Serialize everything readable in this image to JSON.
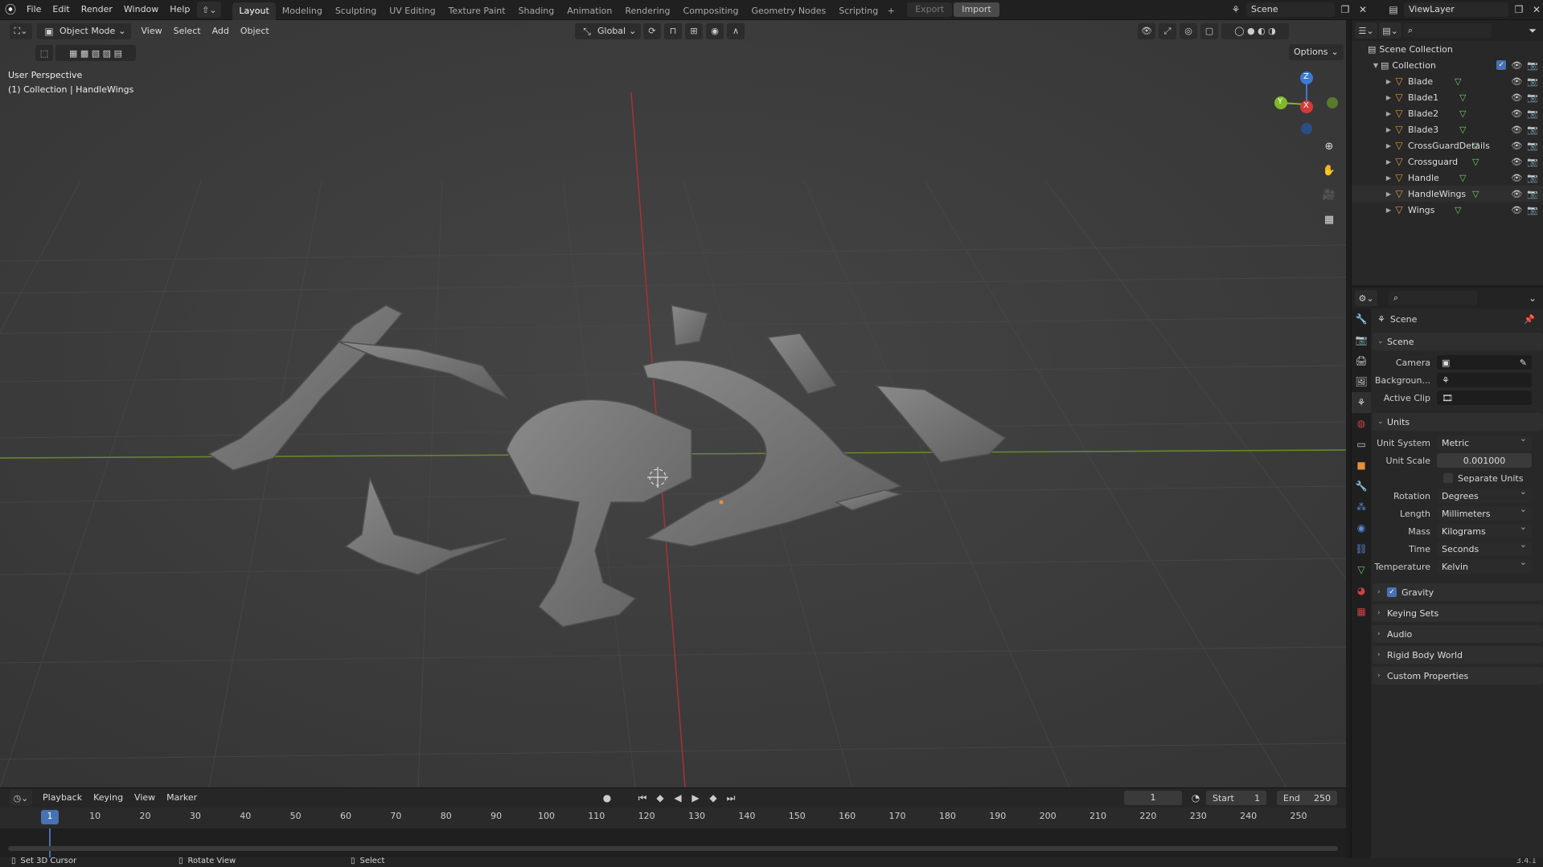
{
  "app": {
    "version": "3.4.1"
  },
  "topbar": {
    "menus": [
      "File",
      "Edit",
      "Render",
      "Window",
      "Help"
    ],
    "workspaces": [
      "Layout",
      "Modeling",
      "Sculpting",
      "UV Editing",
      "Texture Paint",
      "Shading",
      "Animation",
      "Rendering",
      "Compositing",
      "Geometry Nodes",
      "Scripting"
    ],
    "active_workspace": "Layout",
    "export_label": "Export",
    "import_label": "Import",
    "scene_name": "Scene",
    "viewlayer_name": "ViewLayer"
  },
  "viewport": {
    "mode": "Object Mode",
    "menus": [
      "View",
      "Select",
      "Add",
      "Object"
    ],
    "transform_orientation": "Global",
    "options_label": "Options",
    "perspective_label": "User Perspective",
    "collection_info": "(1) Collection | HandleWings",
    "gizmo": {
      "x_label": "X",
      "y_label": "Y",
      "z_label": "Z"
    }
  },
  "timeline": {
    "menus": [
      "Playback",
      "Keying",
      "View",
      "Marker"
    ],
    "current_frame": "1",
    "start_label": "Start",
    "start_value": "1",
    "end_label": "End",
    "end_value": "250",
    "ticks": [
      "1",
      "10",
      "20",
      "30",
      "40",
      "50",
      "60",
      "70",
      "80",
      "90",
      "100",
      "110",
      "120",
      "130",
      "140",
      "150",
      "160",
      "170",
      "180",
      "190",
      "200",
      "210",
      "220",
      "230",
      "240",
      "250"
    ]
  },
  "statusbar": {
    "hint1": "Set 3D Cursor",
    "hint2": "Rotate View",
    "hint3": "Select"
  },
  "outliner": {
    "root": "Scene Collection",
    "collection": "Collection",
    "items": [
      "Blade",
      "Blade1",
      "Blade2",
      "Blade3",
      "CrossGuardDetails",
      "Crossguard",
      "Handle",
      "HandleWings",
      "Wings"
    ]
  },
  "properties": {
    "context": "Scene",
    "scene_panel": "Scene",
    "camera_label": "Camera",
    "background_label": "Backgroun...",
    "active_clip_label": "Active Clip",
    "units_panel": "Units",
    "unit_system_label": "Unit System",
    "unit_system": "Metric",
    "unit_scale_label": "Unit Scale",
    "unit_scale": "0.001000",
    "separate_units": "Separate Units",
    "rotation_label": "Rotation",
    "rotation": "Degrees",
    "length_label": "Length",
    "length": "Millimeters",
    "mass_label": "Mass",
    "mass": "Kilograms",
    "time_label": "Time",
    "time": "Seconds",
    "temperature_label": "Temperature",
    "temperature": "Kelvin",
    "gravity": "Gravity",
    "keying_sets": "Keying Sets",
    "audio": "Audio",
    "rigid_body_world": "Rigid Body World",
    "custom_properties": "Custom Properties"
  },
  "colors": {
    "accent": "#4772b3",
    "x_axis": "#d33b3b",
    "y_axis": "#7fb92a",
    "z_axis": "#3b7bd3",
    "mesh": "#e7903a"
  }
}
